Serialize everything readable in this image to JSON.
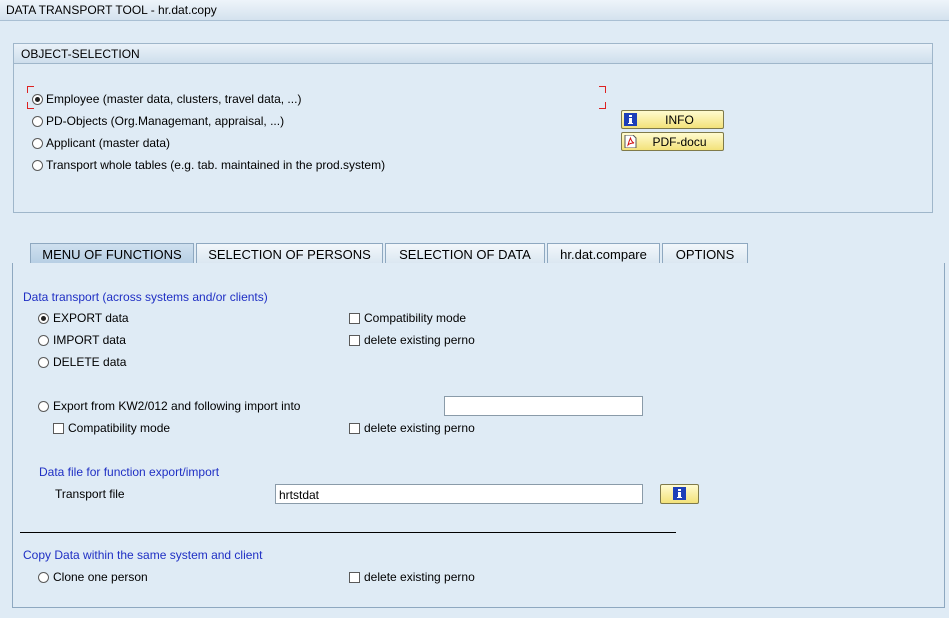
{
  "window": {
    "title": "DATA TRANSPORT TOOL - hr.dat.copy"
  },
  "object_selection": {
    "header": "OBJECT-SELECTION",
    "options": [
      {
        "label": "Employee (master data, clusters, travel data, ...)",
        "selected": true
      },
      {
        "label": "PD-Objects (Org.Managemant, appraisal, ...)",
        "selected": false
      },
      {
        "label": "Applicant (master data)",
        "selected": false
      },
      {
        "label": "Transport whole tables (e.g. tab. maintained in the prod.system)",
        "selected": false
      }
    ],
    "info_button": "INFO",
    "pdf_button": "PDF-docu"
  },
  "tabs": [
    {
      "label": "MENU OF FUNCTIONS",
      "active": true
    },
    {
      "label": "SELECTION OF PERSONS",
      "active": false
    },
    {
      "label": "SELECTION OF DATA",
      "active": false
    },
    {
      "label": "hr.dat.compare",
      "active": false
    },
    {
      "label": "OPTIONS",
      "active": false
    }
  ],
  "menu": {
    "data_transport_heading": "Data transport (across systems and/or clients)",
    "export_label": "EXPORT data",
    "import_label": "IMPORT data",
    "delete_label": "DELETE data",
    "compat_mode_label": "Compatibility mode",
    "delete_perno_label": "delete existing perno",
    "export_import_label": "Export from KW2/012 and following import into",
    "export_import_value": "",
    "compat_mode_label_2": "Compatibility mode",
    "delete_perno_label_2": "delete existing perno",
    "data_file_heading": "Data file for function export/import",
    "transport_file_label": "Transport file",
    "transport_file_value": "hrtstdat",
    "copy_heading": "Copy Data within the same system and client",
    "clone_label": "Clone one person",
    "delete_perno_label_3": "delete existing perno"
  },
  "colors": {
    "background": "#dfebf5",
    "heading_blue": "#1f2fc4",
    "button_yellow": "#f3e27a"
  }
}
